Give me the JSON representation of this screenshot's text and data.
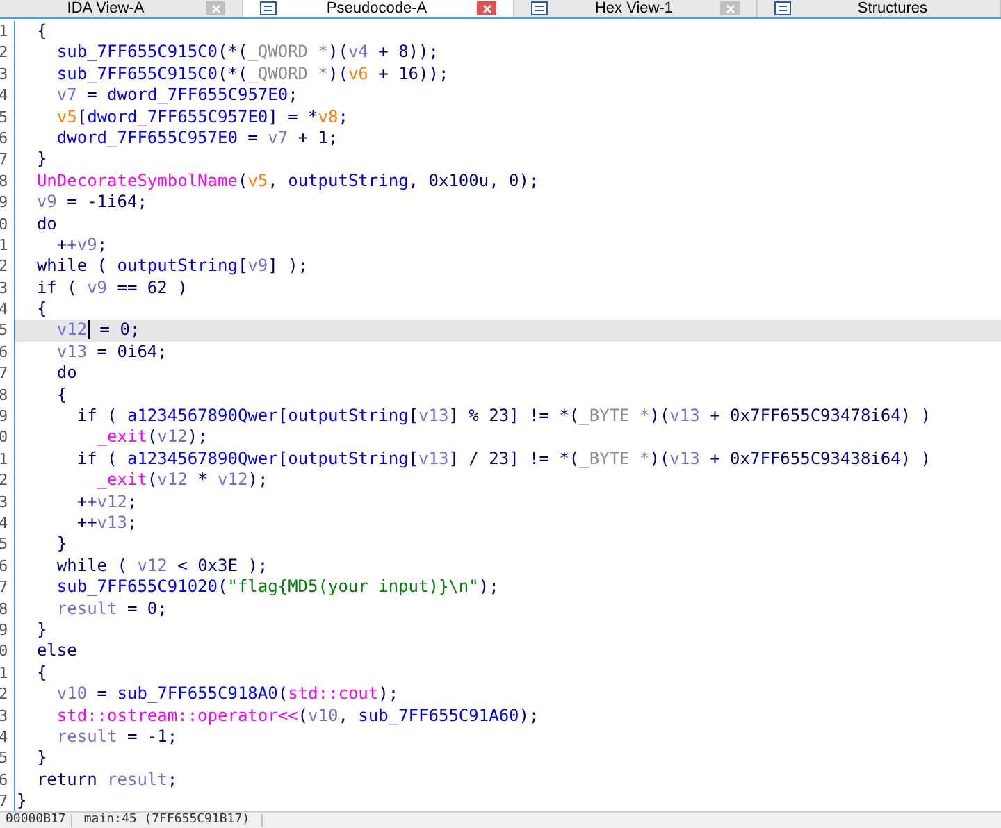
{
  "tabs": [
    {
      "label": "IDA View-A",
      "selected": false,
      "closable": true
    },
    {
      "label": "Pseudocode-A",
      "selected": true,
      "closable": true
    },
    {
      "label": "Hex View-1",
      "selected": false,
      "closable": true
    },
    {
      "label": "Structures",
      "selected": false,
      "closable": false
    }
  ],
  "code_lines": [
    {
      "number": "1",
      "selected": false,
      "tokens": [
        {
          "kind": "plain",
          "text": "  {"
        }
      ]
    },
    {
      "number": "2",
      "selected": false,
      "tokens": [
        {
          "kind": "global",
          "text": "    sub_7FF655C915C0"
        },
        {
          "kind": "plain",
          "text": "(*("
        },
        {
          "kind": "type",
          "text": "_QWORD *"
        },
        {
          "kind": "plain",
          "text": ")("
        },
        {
          "kind": "local",
          "text": "v4"
        },
        {
          "kind": "plain",
          "text": " + 8));"
        }
      ]
    },
    {
      "number": "3",
      "selected": false,
      "tokens": [
        {
          "kind": "global",
          "text": "    sub_7FF655C915C0"
        },
        {
          "kind": "plain",
          "text": "(*("
        },
        {
          "kind": "type",
          "text": "_QWORD *"
        },
        {
          "kind": "plain",
          "text": ")("
        },
        {
          "kind": "arg",
          "text": "v6"
        },
        {
          "kind": "plain",
          "text": " + 16));"
        }
      ]
    },
    {
      "number": "4",
      "selected": false,
      "tokens": [
        {
          "kind": "local",
          "text": "    v7"
        },
        {
          "kind": "plain",
          "text": " = "
        },
        {
          "kind": "global",
          "text": "dword_7FF655C957E0"
        },
        {
          "kind": "plain",
          "text": ";"
        }
      ]
    },
    {
      "number": "5",
      "selected": false,
      "tokens": [
        {
          "kind": "arg",
          "text": "    v5"
        },
        {
          "kind": "plain",
          "text": "["
        },
        {
          "kind": "global",
          "text": "dword_7FF655C957E0"
        },
        {
          "kind": "plain",
          "text": "] = *"
        },
        {
          "kind": "arg",
          "text": "v8"
        },
        {
          "kind": "plain",
          "text": ";"
        }
      ]
    },
    {
      "number": "6",
      "selected": false,
      "tokens": [
        {
          "kind": "global",
          "text": "    dword_7FF655C957E0"
        },
        {
          "kind": "plain",
          "text": " = "
        },
        {
          "kind": "local",
          "text": "v7"
        },
        {
          "kind": "plain",
          "text": " + 1;"
        }
      ]
    },
    {
      "number": "7",
      "selected": false,
      "tokens": [
        {
          "kind": "plain",
          "text": "  }"
        }
      ]
    },
    {
      "number": "8",
      "selected": false,
      "tokens": [
        {
          "kind": "import",
          "text": "  UnDecorateSymbolName"
        },
        {
          "kind": "plain",
          "text": "("
        },
        {
          "kind": "arg",
          "text": "v5"
        },
        {
          "kind": "plain",
          "text": ", "
        },
        {
          "kind": "global",
          "text": "outputString"
        },
        {
          "kind": "plain",
          "text": ", 0x100u, 0);"
        }
      ]
    },
    {
      "number": "9",
      "selected": false,
      "tokens": [
        {
          "kind": "local",
          "text": "  v9"
        },
        {
          "kind": "plain",
          "text": " = -1i64;"
        }
      ]
    },
    {
      "number": "0",
      "selected": false,
      "tokens": [
        {
          "kind": "plain",
          "text": "  do"
        }
      ]
    },
    {
      "number": "1",
      "selected": false,
      "tokens": [
        {
          "kind": "plain",
          "text": "    ++"
        },
        {
          "kind": "local",
          "text": "v9"
        },
        {
          "kind": "plain",
          "text": ";"
        }
      ]
    },
    {
      "number": "2",
      "selected": false,
      "tokens": [
        {
          "kind": "plain",
          "text": "  while ( "
        },
        {
          "kind": "global",
          "text": "outputString"
        },
        {
          "kind": "plain",
          "text": "["
        },
        {
          "kind": "local",
          "text": "v9"
        },
        {
          "kind": "plain",
          "text": "] );"
        }
      ]
    },
    {
      "number": "3",
      "selected": false,
      "tokens": [
        {
          "kind": "plain",
          "text": "  if ( "
        },
        {
          "kind": "local",
          "text": "v9"
        },
        {
          "kind": "plain",
          "text": " == 62 )"
        }
      ]
    },
    {
      "number": "4",
      "selected": false,
      "tokens": [
        {
          "kind": "plain",
          "text": "  {"
        }
      ]
    },
    {
      "number": "5",
      "selected": true,
      "tokens": [
        {
          "kind": "local",
          "text": "    v12",
          "caret": true
        },
        {
          "kind": "plain",
          "text": " = 0;"
        }
      ]
    },
    {
      "number": "6",
      "selected": false,
      "tokens": [
        {
          "kind": "local",
          "text": "    v13"
        },
        {
          "kind": "plain",
          "text": " = 0i64;"
        }
      ]
    },
    {
      "number": "7",
      "selected": false,
      "tokens": [
        {
          "kind": "plain",
          "text": "    do"
        }
      ]
    },
    {
      "number": "8",
      "selected": false,
      "tokens": [
        {
          "kind": "plain",
          "text": "    {"
        }
      ]
    },
    {
      "number": "9",
      "selected": false,
      "tokens": [
        {
          "kind": "plain",
          "text": "      if ( "
        },
        {
          "kind": "global",
          "text": "a1234567890Qwer"
        },
        {
          "kind": "plain",
          "text": "["
        },
        {
          "kind": "global",
          "text": "outputString"
        },
        {
          "kind": "plain",
          "text": "["
        },
        {
          "kind": "local",
          "text": "v13"
        },
        {
          "kind": "plain",
          "text": "] % 23] != *("
        },
        {
          "kind": "type",
          "text": "_BYTE *"
        },
        {
          "kind": "plain",
          "text": ")("
        },
        {
          "kind": "local",
          "text": "v13"
        },
        {
          "kind": "plain",
          "text": " + 0x7FF655C93478i64) )"
        }
      ]
    },
    {
      "number": "0",
      "selected": false,
      "tokens": [
        {
          "kind": "import",
          "text": "        _exit"
        },
        {
          "kind": "plain",
          "text": "("
        },
        {
          "kind": "local",
          "text": "v12"
        },
        {
          "kind": "plain",
          "text": ");"
        }
      ]
    },
    {
      "number": "1",
      "selected": false,
      "tokens": [
        {
          "kind": "plain",
          "text": "      if ( "
        },
        {
          "kind": "global",
          "text": "a1234567890Qwer"
        },
        {
          "kind": "plain",
          "text": "["
        },
        {
          "kind": "global",
          "text": "outputString"
        },
        {
          "kind": "plain",
          "text": "["
        },
        {
          "kind": "local",
          "text": "v13"
        },
        {
          "kind": "plain",
          "text": "] / 23] != *("
        },
        {
          "kind": "type",
          "text": "_BYTE *"
        },
        {
          "kind": "plain",
          "text": ")("
        },
        {
          "kind": "local",
          "text": "v13"
        },
        {
          "kind": "plain",
          "text": " + 0x7FF655C93438i64) )"
        }
      ]
    },
    {
      "number": "2",
      "selected": false,
      "tokens": [
        {
          "kind": "import",
          "text": "        _exit"
        },
        {
          "kind": "plain",
          "text": "("
        },
        {
          "kind": "local",
          "text": "v12"
        },
        {
          "kind": "plain",
          "text": " * "
        },
        {
          "kind": "local",
          "text": "v12"
        },
        {
          "kind": "plain",
          "text": ");"
        }
      ]
    },
    {
      "number": "3",
      "selected": false,
      "tokens": [
        {
          "kind": "plain",
          "text": "      ++"
        },
        {
          "kind": "local",
          "text": "v12"
        },
        {
          "kind": "plain",
          "text": ";"
        }
      ]
    },
    {
      "number": "4",
      "selected": false,
      "tokens": [
        {
          "kind": "plain",
          "text": "      ++"
        },
        {
          "kind": "local",
          "text": "v13"
        },
        {
          "kind": "plain",
          "text": ";"
        }
      ]
    },
    {
      "number": "5",
      "selected": false,
      "tokens": [
        {
          "kind": "plain",
          "text": "    }"
        }
      ]
    },
    {
      "number": "6",
      "selected": false,
      "tokens": [
        {
          "kind": "plain",
          "text": "    while ( "
        },
        {
          "kind": "local",
          "text": "v12"
        },
        {
          "kind": "plain",
          "text": " < 0x3E );"
        }
      ]
    },
    {
      "number": "7",
      "selected": false,
      "tokens": [
        {
          "kind": "global",
          "text": "    sub_7FF655C91020"
        },
        {
          "kind": "plain",
          "text": "("
        },
        {
          "kind": "string",
          "text": "\"flag{MD5(your input)}\\n\""
        },
        {
          "kind": "plain",
          "text": ");"
        }
      ]
    },
    {
      "number": "8",
      "selected": false,
      "tokens": [
        {
          "kind": "local",
          "text": "    result"
        },
        {
          "kind": "plain",
          "text": " = 0;"
        }
      ]
    },
    {
      "number": "9",
      "selected": false,
      "tokens": [
        {
          "kind": "plain",
          "text": "  }"
        }
      ]
    },
    {
      "number": "0",
      "selected": false,
      "tokens": [
        {
          "kind": "plain",
          "text": "  else"
        }
      ]
    },
    {
      "number": "1",
      "selected": false,
      "tokens": [
        {
          "kind": "plain",
          "text": "  {"
        }
      ]
    },
    {
      "number": "2",
      "selected": false,
      "tokens": [
        {
          "kind": "local",
          "text": "    v10"
        },
        {
          "kind": "plain",
          "text": " = "
        },
        {
          "kind": "global",
          "text": "sub_7FF655C918A0"
        },
        {
          "kind": "plain",
          "text": "("
        },
        {
          "kind": "import",
          "text": "std::cout"
        },
        {
          "kind": "plain",
          "text": ");"
        }
      ]
    },
    {
      "number": "3",
      "selected": false,
      "tokens": [
        {
          "kind": "import",
          "text": "    std::ostream::operator<<"
        },
        {
          "kind": "plain",
          "text": "("
        },
        {
          "kind": "local",
          "text": "v10"
        },
        {
          "kind": "plain",
          "text": ", "
        },
        {
          "kind": "global",
          "text": "sub_7FF655C91A60"
        },
        {
          "kind": "plain",
          "text": ");"
        }
      ]
    },
    {
      "number": "4",
      "selected": false,
      "tokens": [
        {
          "kind": "local",
          "text": "    result"
        },
        {
          "kind": "plain",
          "text": " = -1;"
        }
      ]
    },
    {
      "number": "5",
      "selected": false,
      "tokens": [
        {
          "kind": "plain",
          "text": "  }"
        }
      ]
    },
    {
      "number": "6",
      "selected": false,
      "tokens": [
        {
          "kind": "plain",
          "text": "  return "
        },
        {
          "kind": "local",
          "text": "result"
        },
        {
          "kind": "plain",
          "text": ";"
        }
      ]
    },
    {
      "number": "7",
      "selected": false,
      "tokens": [
        {
          "kind": "plain",
          "text": "}"
        }
      ]
    }
  ],
  "status_bar": {
    "offset": "00000B17",
    "location": "main:45 (7FF655C91B17)"
  }
}
